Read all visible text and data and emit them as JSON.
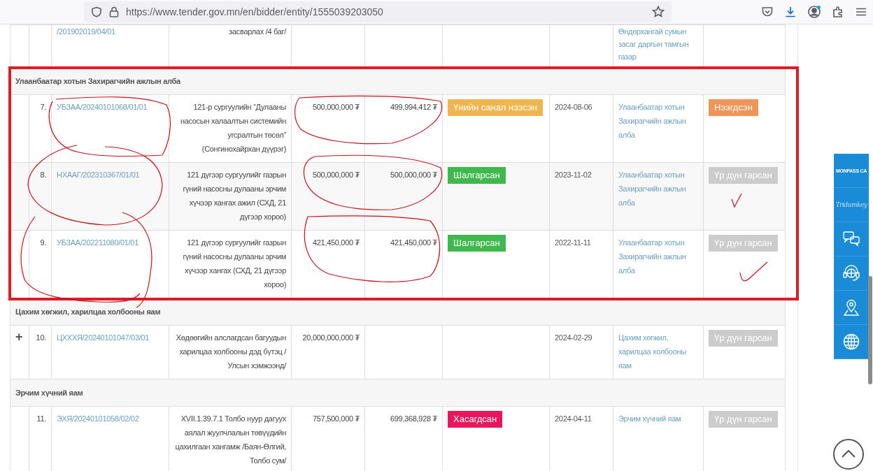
{
  "browser": {
    "url": "https://www.tender.gov.mn/en/bidder/entity/1555039203050"
  },
  "partial_row": {
    "reference": "/201902019/04/01",
    "description": "засварлах /4 баг/",
    "organization": "Өндөрхангай сумын засаг даргын тамгын газар"
  },
  "groups": [
    {
      "title": "Улаанбаатар хотын Захирагчийн ажлын алба",
      "rows": [
        {
          "number": "7.",
          "reference": "УБЗАА/20240101068/01/01",
          "description": "121-р сургуулийн “Дулааны насосын халаалтын системийн угсралтын төсөл” (Сонгинохайрхан дүүрэг)",
          "budget": "500,000,000 ₮",
          "offer": "499,994,412 ₮",
          "status": {
            "text": "Үнийн санал нээсэн",
            "color": "#f0b54e"
          },
          "date": "2024-08-06",
          "organization": "Улаанбаатар хотын Захирагчийн ажлын алба",
          "result": {
            "text": "Нээгдсэн",
            "color": "#f0955a"
          }
        },
        {
          "number": "8.",
          "reference": "НХААГ/202310367/01/01",
          "description": "121 дүгээр сургуулийг газрын гүний насосны дулааны эрчим хүчээр хангах ажил (СХД, 21 дүгээр хороо)",
          "budget": "500,000,000 ₮",
          "offer": "500,000,000 ₮",
          "status": {
            "text": "Шалгарсан",
            "color": "#3fb94e"
          },
          "date": "2023-11-02",
          "organization": "Улаанбаатар хотын Захирагчийн ажлын алба",
          "result": {
            "text": "Үр дүн гарсан",
            "color": "#cccccc"
          }
        },
        {
          "number": "9.",
          "reference": "УБЗАА/202211080/01/01",
          "description": "121 дүгээр сургуулийг газрын гүний насосны дулааны эрчим хүчээр хангах (СХД, 21 дүгээр хороо)",
          "budget": "421,450,000 ₮",
          "offer": "421,450,000 ₮",
          "status": {
            "text": "Шалгарсан",
            "color": "#3fb94e"
          },
          "date": "2022-11-11",
          "organization": "Улаанбаатар хотын Захирагчийн ажлын алба",
          "result": {
            "text": "Үр дүн гарсан",
            "color": "#cccccc"
          }
        }
      ]
    },
    {
      "title": "Цахим хөгжил, харилцаа холбооны яам",
      "rows": [
        {
          "toggle": "+",
          "number": "10.",
          "reference": "ЦХХХЯ/20240101047/03/01",
          "description": "Хөдөөгийн алслагдсан багуудын харилцаа холбооны дэд бүтэц /Улсын хэмжээнд/",
          "budget": "20,000,000,000 ₮",
          "date": "2024-02-29",
          "organization": "Цахим хөгжил, харилцаа холбооны яам",
          "result": {
            "text": "Үр дүн гарсан",
            "color": "#cccccc"
          }
        }
      ]
    },
    {
      "title": "Эрчим хүчний яам",
      "rows": [
        {
          "number": "11.",
          "reference": "ЭХЯ/20240101058/02/02",
          "description": "XVII.1.39.7.1 Толбо нуур дагуух аялал жуулчлалын төвүүдийн цахилгаан хангамж /Баян-Өлгий, Толбо сум/",
          "budget": "757,500,000 ₮",
          "offer": "699,368,928 ₮",
          "status": {
            "text": "Хасагдсан",
            "color": "#e8175d"
          },
          "date": "2024-04-11",
          "organization": "Эрчим хүчний яам",
          "result": {
            "text": "Үр дүн гарсан",
            "color": "#cccccc"
          }
        }
      ]
    }
  ],
  "side_widget": [
    {
      "kind": "logo",
      "text": "MONPASS CA"
    },
    {
      "kind": "script",
      "text": "Tridumkey"
    },
    {
      "kind": "chat"
    },
    {
      "kind": "support"
    },
    {
      "kind": "location"
    },
    {
      "kind": "globe"
    }
  ]
}
